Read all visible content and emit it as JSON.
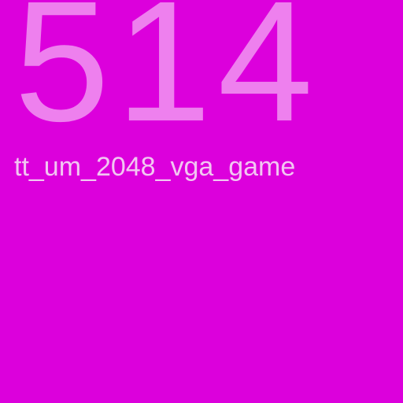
{
  "screen": {
    "number": "514",
    "project_name": "tt_um_2048_vga_game"
  },
  "colors": {
    "background": "#dc00dc",
    "number": "#ee80ee",
    "text": "#f2c6f2"
  }
}
